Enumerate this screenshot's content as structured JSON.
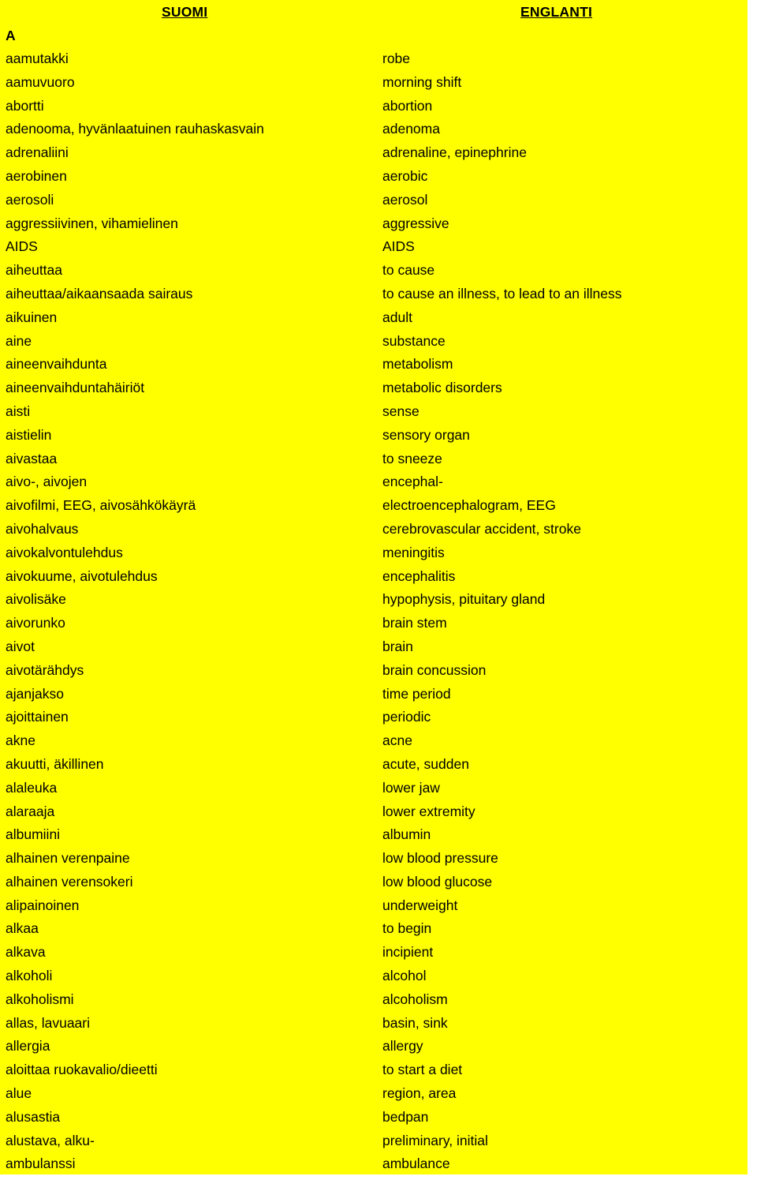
{
  "page": {
    "background_color": "#ffff00",
    "text_color": "#000000"
  },
  "headers": {
    "source_language": "SUOMI",
    "target_language": "ENGLANTI"
  },
  "section_letter": "A",
  "columns": [
    "SUOMI",
    "ENGLANTI"
  ],
  "entries": [
    {
      "fi": "aamutakki",
      "en": "robe"
    },
    {
      "fi": "aamuvuoro",
      "en": "morning shift"
    },
    {
      "fi": "abortti",
      "en": "abortion"
    },
    {
      "fi": "adenooma, hyvänlaatuinen rauhaskasvain",
      "en": "adenoma"
    },
    {
      "fi": "adrenaliini",
      "en": "adrenaline, epinephrine"
    },
    {
      "fi": "aerobinen",
      "en": "aerobic"
    },
    {
      "fi": "aerosoli",
      "en": "aerosol"
    },
    {
      "fi": "aggressiivinen, vihamielinen",
      "en": "aggressive"
    },
    {
      "fi": "AIDS",
      "en": "AIDS"
    },
    {
      "fi": "aiheuttaa",
      "en": "to cause"
    },
    {
      "fi": "aiheuttaa/aikaansaada sairaus",
      "en": "to cause an illness, to lead to an illness"
    },
    {
      "fi": "aikuinen",
      "en": "adult"
    },
    {
      "fi": "aine",
      "en": "substance"
    },
    {
      "fi": "aineenvaihdunta",
      "en": "metabolism"
    },
    {
      "fi": "aineenvaihduntahäiriöt",
      "en": "metabolic disorders"
    },
    {
      "fi": "aisti",
      "en": "sense"
    },
    {
      "fi": "aistielin",
      "en": "sensory organ"
    },
    {
      "fi": "aivastaa",
      "en": "to sneeze"
    },
    {
      "fi": "aivo-, aivojen",
      "en": "encephal-"
    },
    {
      "fi": "aivofilmi, EEG, aivosähkökäyrä",
      "en": "electroencephalogram, EEG"
    },
    {
      "fi": "aivohalvaus",
      "en": "cerebrovascular accident, stroke"
    },
    {
      "fi": "aivokalvontulehdus",
      "en": "meningitis"
    },
    {
      "fi": "aivokuume, aivotulehdus",
      "en": "encephalitis"
    },
    {
      "fi": "aivolisäke",
      "en": "hypophysis, pituitary gland"
    },
    {
      "fi": "aivorunko",
      "en": "brain stem"
    },
    {
      "fi": "aivot",
      "en": "brain"
    },
    {
      "fi": "aivotärähdys",
      "en": "brain concussion"
    },
    {
      "fi": "ajanjakso",
      "en": "time period"
    },
    {
      "fi": "ajoittainen",
      "en": "periodic"
    },
    {
      "fi": "akne",
      "en": "acne"
    },
    {
      "fi": "akuutti, äkillinen",
      "en": "acute, sudden"
    },
    {
      "fi": "alaleuka",
      "en": "lower jaw"
    },
    {
      "fi": "alaraaja",
      "en": "lower extremity"
    },
    {
      "fi": "albumiini",
      "en": "albumin"
    },
    {
      "fi": "alhainen verenpaine",
      "en": "low blood pressure"
    },
    {
      "fi": "alhainen verensokeri",
      "en": "low blood glucose"
    },
    {
      "fi": "alipainoinen",
      "en": "underweight"
    },
    {
      "fi": "alkaa",
      "en": "to begin"
    },
    {
      "fi": "alkava",
      "en": "incipient"
    },
    {
      "fi": "alkoholi",
      "en": "alcohol"
    },
    {
      "fi": "alkoholismi",
      "en": "alcoholism"
    },
    {
      "fi": "allas, lavuaari",
      "en": "basin, sink"
    },
    {
      "fi": "allergia",
      "en": "allergy"
    },
    {
      "fi": "aloittaa ruokavalio/dieetti",
      "en": "to start a diet"
    },
    {
      "fi": "alue",
      "en": "region, area"
    },
    {
      "fi": "alusastia",
      "en": "bedpan"
    },
    {
      "fi": "alustava, alku-",
      "en": "preliminary, initial"
    },
    {
      "fi": "ambulanssi",
      "en": "ambulance"
    }
  ]
}
